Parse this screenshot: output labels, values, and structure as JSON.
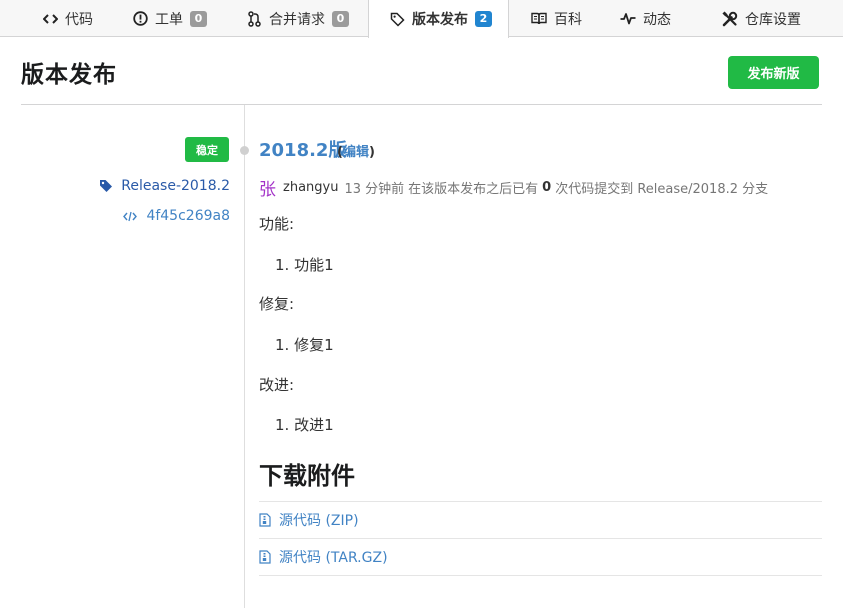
{
  "tabs": [
    {
      "id": "code",
      "label": "代码",
      "icon": "code-icon"
    },
    {
      "id": "issues",
      "label": "工单",
      "icon": "issue-icon",
      "count": "0"
    },
    {
      "id": "pulls",
      "label": "合并请求",
      "icon": "pull-request-icon",
      "count": "0"
    },
    {
      "id": "releases",
      "label": "版本发布",
      "icon": "tag-icon",
      "count": "2",
      "active": true
    },
    {
      "id": "wiki",
      "label": "百科",
      "icon": "book-icon"
    },
    {
      "id": "activity",
      "label": "动态",
      "icon": "pulse-icon"
    },
    {
      "id": "settings",
      "label": "仓库设置",
      "icon": "tools-icon"
    }
  ],
  "page": {
    "title": "版本发布",
    "new_release_button": "发布新版"
  },
  "release": {
    "stable_label": "稳定",
    "tag": "Release-2018.2",
    "commit": "4f45c269a8",
    "title": "2018.2版",
    "edit_prefix": "(",
    "edit_label": "编辑",
    "edit_suffix": ")",
    "author_avatar_char": "张",
    "author": "zhangyu",
    "time_ago": "13 分钟前",
    "since_text": "在该版本发布之后已有",
    "commits_since": "0",
    "commits_text": "次代码提交到 Release/2018.2 分支",
    "notes": {
      "feature_heading": "功能:",
      "feature_item": "1. 功能1",
      "fix_heading": "修复:",
      "fix_item": "1. 修复1",
      "improve_heading": "改进:",
      "improve_item": "1. 改进1"
    }
  },
  "downloads": {
    "title": "下载附件",
    "zip_label": "源代码 (ZIP)",
    "targz_label": "源代码 (TAR.GZ)"
  },
  "colors": {
    "accent_green": "#21ba45",
    "link_blue": "#4183c4",
    "badge_blue": "#2185d0",
    "avatar_purple": "#a333c8"
  }
}
